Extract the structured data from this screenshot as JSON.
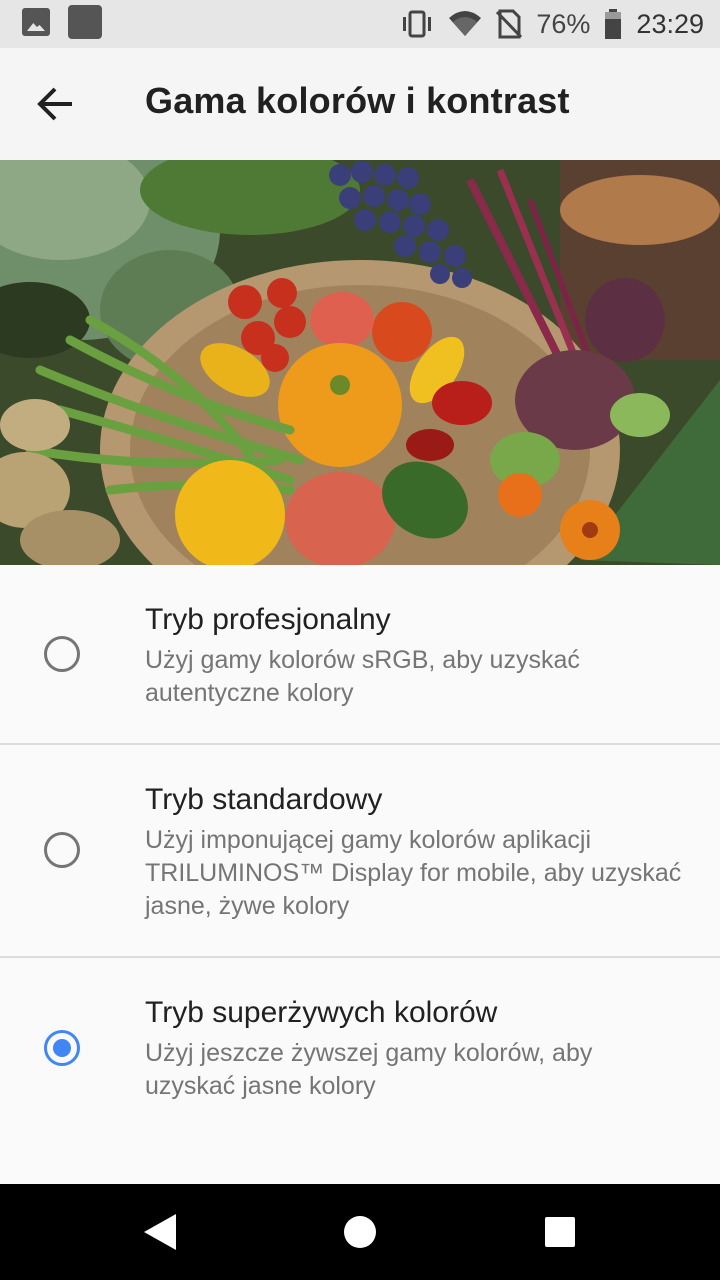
{
  "status_bar": {
    "icons_left": [
      "image-icon",
      "app-icon"
    ],
    "icons_right": [
      "vibrate-icon",
      "wifi-icon",
      "no-sim-icon",
      "battery-icon"
    ],
    "battery": "76%",
    "time": "23:29"
  },
  "app_bar": {
    "title": "Gama kolorów i kontrast",
    "back_icon": "arrow-left-icon"
  },
  "hero": {
    "image": "vegetables-photo"
  },
  "options": [
    {
      "title": "Tryb profesjonalny",
      "description": "Użyj gamy kolorów sRGB, aby uzyskać autentyczne kolory",
      "selected": false
    },
    {
      "title": "Tryb standardowy",
      "description": "Użyj imponującej gamy kolorów aplikacji TRILUMINOS™ Display for mobile, aby uzyskać jasne, żywe kolory",
      "selected": false
    },
    {
      "title": "Tryb superżywych kolorów",
      "description": "Użyj jeszcze żywszej gamy kolorów, aby uzyskać jasne kolory",
      "selected": true
    }
  ],
  "nav_bar": {
    "buttons": [
      "back-triangle-icon",
      "home-circle-icon",
      "recents-square-icon"
    ]
  },
  "colors": {
    "accent": "#4285f4",
    "status_bar_bg": "#e6e6e6",
    "app_bar_bg": "#f5f5f5",
    "nav_bar_bg": "#000000"
  }
}
